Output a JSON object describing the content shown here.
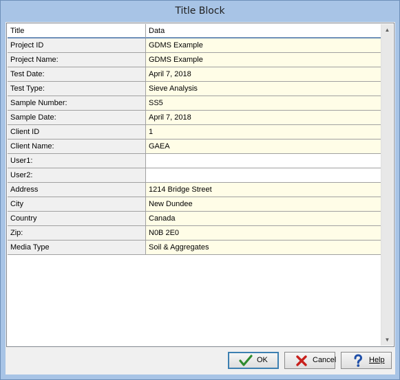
{
  "window": {
    "title": "Title Block"
  },
  "grid": {
    "columns": [
      "Title",
      "Data"
    ],
    "rows": [
      {
        "title": "Project ID",
        "data": "GDMS Example"
      },
      {
        "title": "Project Name:",
        "data": "GDMS Example"
      },
      {
        "title": "Test Date:",
        "data": "April 7, 2018"
      },
      {
        "title": "Test Type:",
        "data": "Sieve Analysis"
      },
      {
        "title": "Sample Number:",
        "data": "SS5"
      },
      {
        "title": "Sample Date:",
        "data": "April 7, 2018"
      },
      {
        "title": "Client ID",
        "data": "1"
      },
      {
        "title": "Client Name:",
        "data": "GAEA"
      },
      {
        "title": "User1:",
        "data": ""
      },
      {
        "title": "User2:",
        "data": ""
      },
      {
        "title": "Address",
        "data": "1214 Bridge Street"
      },
      {
        "title": "City",
        "data": "New Dundee"
      },
      {
        "title": "Country",
        "data": "Canada"
      },
      {
        "title": "Zip:",
        "data": "N0B 2E0"
      },
      {
        "title": "Media Type",
        "data": "Soil & Aggregates"
      }
    ]
  },
  "buttons": {
    "ok_label": "OK",
    "cancel_label": "Cancel",
    "help_label": "Help"
  },
  "colors": {
    "frame": "#a8c4e6",
    "data_cell": "#fffde7",
    "title_cell": "#f0f0f0",
    "ok_check": "#2e8b2e",
    "cancel_x": "#c8201c",
    "help_q": "#1f4fa8"
  },
  "icons": {
    "ok": "check-icon",
    "cancel": "x-icon",
    "help": "question-icon"
  }
}
